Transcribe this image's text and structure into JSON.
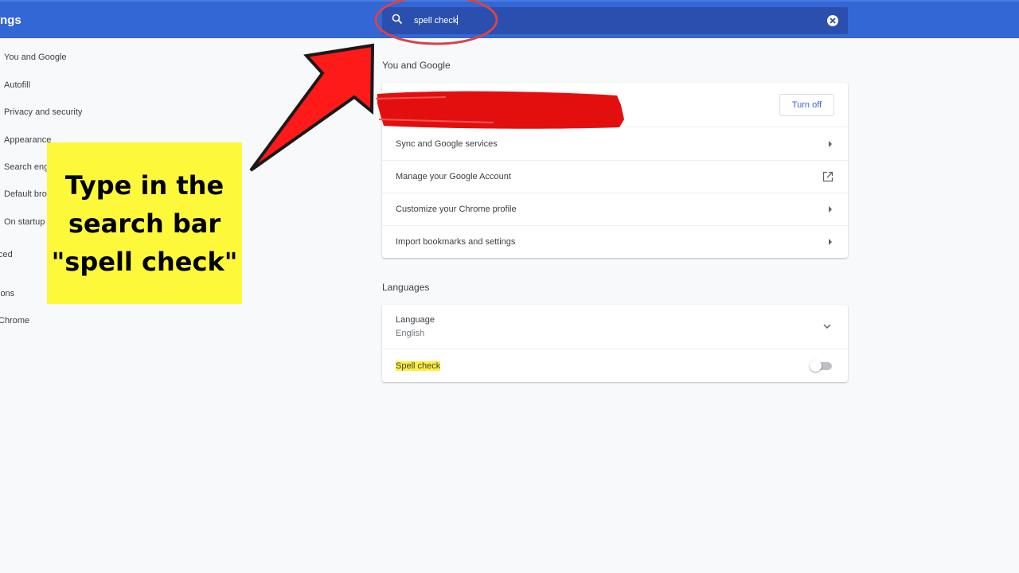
{
  "header": {
    "title": "ngs",
    "search": {
      "value": "spell check",
      "icon": "search-icon",
      "clear_icon": "clear-icon"
    }
  },
  "sidebar": {
    "items": [
      {
        "label": "You and Google"
      },
      {
        "label": "Autofill"
      },
      {
        "label": "Privacy and security"
      },
      {
        "label": "Appearance"
      },
      {
        "label": "Search eng"
      },
      {
        "label": "Default bro"
      },
      {
        "label": "On startup"
      },
      {
        "label": "ced"
      },
      {
        "label": "ions"
      },
      {
        "label": "Chrome"
      }
    ]
  },
  "main": {
    "you_and_google": {
      "heading": "You and Google",
      "turn_off": "Turn off",
      "rows": [
        {
          "label": "Sync and Google services"
        },
        {
          "label": "Manage your Google Account"
        },
        {
          "label": "Customize your Chrome profile"
        },
        {
          "label": "Import bookmarks and settings"
        }
      ]
    },
    "languages": {
      "heading": "Languages",
      "language_label": "Language",
      "language_value": "English",
      "spell_check": "Spell check",
      "spell_check_enabled": false
    }
  },
  "annotation": {
    "callout_lines": [
      "Type in the",
      "search bar",
      "\"spell check\""
    ],
    "colors": {
      "callout": "#fdf83a",
      "arrow": "#ff1a1a",
      "header": "#3367d6"
    }
  }
}
